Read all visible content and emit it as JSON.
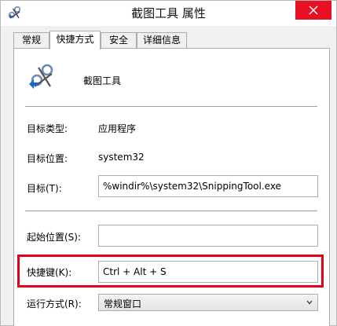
{
  "window": {
    "title": "截图工具 属性",
    "close_icon": "close-icon"
  },
  "tabs": [
    {
      "label": "常规",
      "active": false
    },
    {
      "label": "快捷方式",
      "active": true
    },
    {
      "label": "安全",
      "active": false
    },
    {
      "label": "详细信息",
      "active": false
    }
  ],
  "header": {
    "icon": "snipping-tool-icon",
    "name": "截图工具"
  },
  "fields": {
    "target_type": {
      "label": "目标类型:",
      "value": "应用程序"
    },
    "target_location": {
      "label": "目标位置:",
      "value": "system32"
    },
    "target": {
      "label": "目标(T):",
      "value": "%windir%\\system32\\SnippingTool.exe"
    },
    "start_in": {
      "label": "起始位置(S):",
      "value": ""
    },
    "shortcut_key": {
      "label": "快捷键(K):",
      "value": "Ctrl + Alt + S"
    },
    "run": {
      "label": "运行方式(R):",
      "value": "常规窗口"
    }
  },
  "colors": {
    "highlight": "#e0001a",
    "close_button": "#e81123"
  }
}
